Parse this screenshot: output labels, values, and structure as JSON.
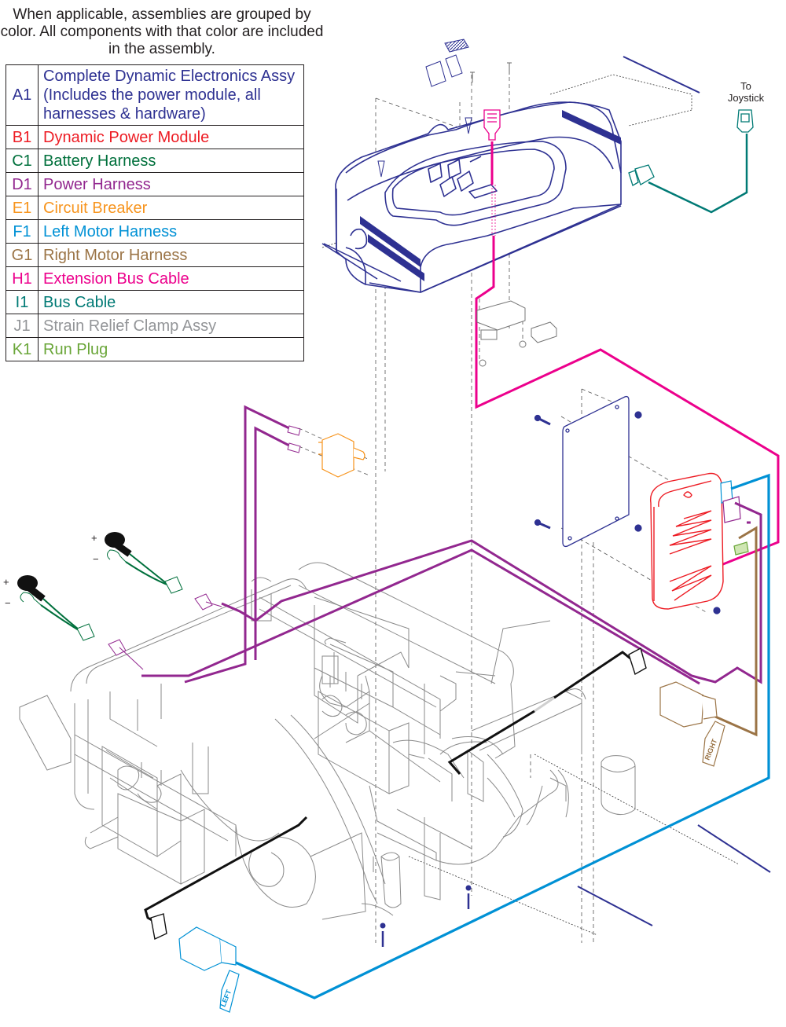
{
  "intro_note": "When applicable, assemblies are grouped by color. All components with that color are included in the assembly.",
  "legend": [
    {
      "code": "A1",
      "label": "Complete Dynamic Electronics Assy (Includes the power module, all harnesses & hardware)",
      "color": "#2e3192"
    },
    {
      "code": "B1",
      "label": "Dynamic Power Module",
      "color": "#ed1c24"
    },
    {
      "code": "C1",
      "label": "Battery Harness",
      "color": "#00703c"
    },
    {
      "code": "D1",
      "label": "Power Harness",
      "color": "#92278f"
    },
    {
      "code": "E1",
      "label": "Circuit Breaker",
      "color": "#f7941d"
    },
    {
      "code": "F1",
      "label": "Left Motor Harness",
      "color": "#0091d5"
    },
    {
      "code": "G1",
      "label": "Right Motor Harness",
      "color": "#9b7446"
    },
    {
      "code": "H1",
      "label": "Extension Bus Cable",
      "color": "#ec008c"
    },
    {
      "code": "I1",
      "label": "Bus Cable",
      "color": "#007a75"
    },
    {
      "code": "J1",
      "label": "Strain Relief Clamp Assy",
      "color": "#939598"
    },
    {
      "code": "K1",
      "label": "Run Plug",
      "color": "#6aa639"
    }
  ],
  "annotations": {
    "to_joystick": "To Joystick",
    "right_tag": "RIGHT",
    "left_tag": "LEFT",
    "battery_plus": "+",
    "battery_minus": "−"
  }
}
